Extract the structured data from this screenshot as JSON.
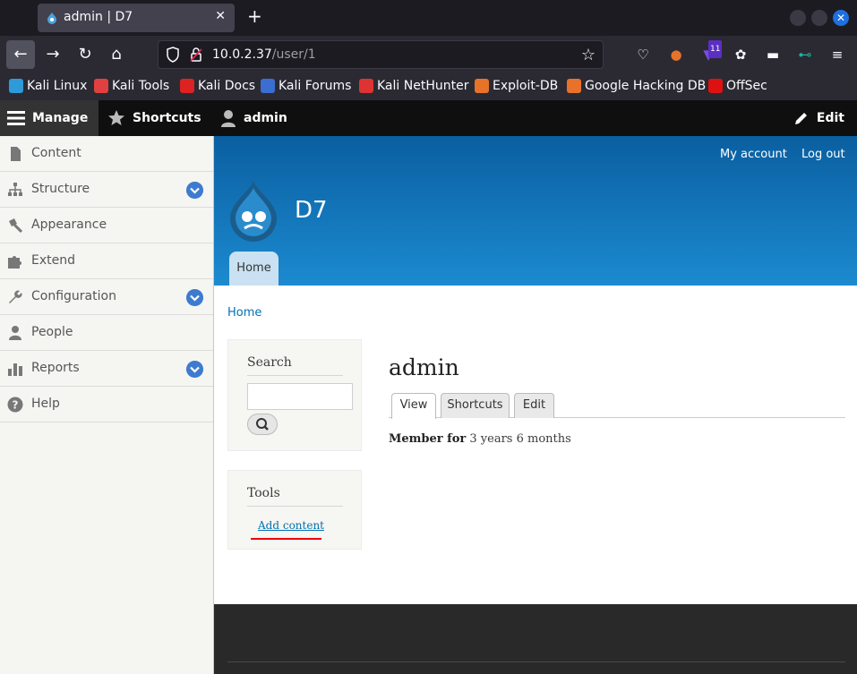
{
  "browser": {
    "tab_title": "admin | D7",
    "tab_close": "✕",
    "new_tab": "+",
    "url_host": "10.0.2.37",
    "url_path": "/user/1",
    "ext_badge": "11"
  },
  "bookmarks": [
    {
      "label": "Kali Linux",
      "color": "#2f9ad9"
    },
    {
      "label": "Kali Tools",
      "color": "#e04040"
    },
    {
      "label": "Kali Docs",
      "color": "#d22"
    },
    {
      "label": "Kali Forums",
      "color": "#3a6fd1"
    },
    {
      "label": "Kali NetHunter",
      "color": "#d33"
    },
    {
      "label": "Exploit-DB",
      "color": "#e8722a"
    },
    {
      "label": "Google Hacking DB",
      "color": "#e8722a"
    },
    {
      "label": "OffSec",
      "color": "#d11"
    }
  ],
  "toolbar": {
    "manage": "Manage",
    "shortcuts": "Shortcuts",
    "user": "admin",
    "edit": "Edit"
  },
  "tray": [
    {
      "label": "Content",
      "icon": "file-icon",
      "expand": false
    },
    {
      "label": "Structure",
      "icon": "sitemap-icon",
      "expand": true
    },
    {
      "label": "Appearance",
      "icon": "brush-icon",
      "expand": false
    },
    {
      "label": "Extend",
      "icon": "puzzle-icon",
      "expand": false
    },
    {
      "label": "Configuration",
      "icon": "wrench-icon",
      "expand": true
    },
    {
      "label": "People",
      "icon": "people-icon",
      "expand": false
    },
    {
      "label": "Reports",
      "icon": "bar-chart-icon",
      "expand": true
    },
    {
      "label": "Help",
      "icon": "help-icon",
      "expand": false
    }
  ],
  "site": {
    "my_account": "My account",
    "log_out": "Log out",
    "name": "D7",
    "home_tab": "Home",
    "breadcrumb": "Home"
  },
  "blocks": {
    "search_title": "Search",
    "tools_title": "Tools",
    "add_content": "Add content"
  },
  "main": {
    "title": "admin",
    "tabs": [
      "View",
      "Shortcuts",
      "Edit"
    ],
    "member_label": "Member for",
    "member_value": "3 years 6 months"
  }
}
